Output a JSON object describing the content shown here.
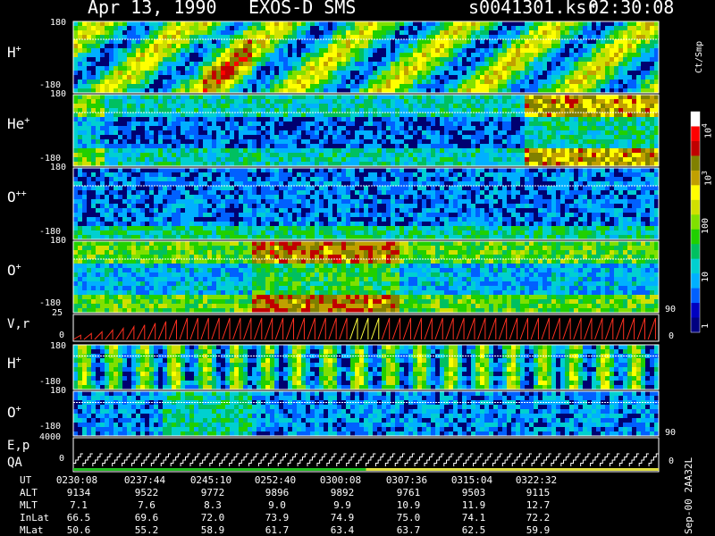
{
  "header": {
    "date": "Apr 13, 1990",
    "instrument": "EXOS-D SMS",
    "file": "s0041301.ksr",
    "time": "02:30:08"
  },
  "chart_data": {
    "type": "heatmap",
    "panels": [
      {
        "id": "h1",
        "label_main": "H",
        "label_sup": "+",
        "y_ticks": [
          "180",
          "-180"
        ],
        "right_ticks": []
      },
      {
        "id": "he",
        "label_main": "He",
        "label_sup": "+",
        "y_ticks": [
          "180",
          "-180"
        ],
        "right_ticks": []
      },
      {
        "id": "opp",
        "label_main": "O",
        "label_sup": "++",
        "y_ticks": [
          "180",
          "-180"
        ],
        "right_ticks": []
      },
      {
        "id": "o1",
        "label_main": "O",
        "label_sup": "+",
        "y_ticks": [
          "180",
          "-180"
        ],
        "right_ticks": [
          "90"
        ]
      },
      {
        "id": "vr",
        "label_main": "V,r",
        "label_sup": "",
        "y_ticks": [
          "25",
          "0"
        ],
        "right_ticks": [
          "0"
        ]
      },
      {
        "id": "h2",
        "label_main": "H",
        "label_sup": "+",
        "y_ticks": [
          "180",
          "-180"
        ],
        "right_ticks": []
      },
      {
        "id": "o2",
        "label_main": "O",
        "label_sup": "+",
        "y_ticks": [
          "180",
          "-180"
        ],
        "right_ticks": [
          "90"
        ]
      },
      {
        "id": "ep",
        "label_main": "E,p",
        "label_sup": "",
        "label2": "QA",
        "y_ticks": [
          "4000",
          "0"
        ],
        "right_ticks": [
          "0"
        ]
      }
    ],
    "colorbar": {
      "units": "Ct/Smp",
      "labels": [
        "10",
        "4",
        "10",
        "3",
        "100",
        "10",
        "1"
      ],
      "scale": "log",
      "range": [
        1,
        10000
      ],
      "colors": [
        "#000080",
        "#0000c0",
        "#0060ff",
        "#00b0ff",
        "#00d0d0",
        "#00c060",
        "#20d000",
        "#80e000",
        "#d0e000",
        "#ffff00",
        "#c0a000",
        "#808000",
        "#c00000",
        "#ff0000",
        "#ffffff"
      ]
    },
    "x_axis": {
      "ut": [
        "0230:08",
        "0237:44",
        "0245:10",
        "0252:40",
        "0300:08",
        "0307:36",
        "0315:04",
        "0322:32"
      ],
      "alt": [
        "9134",
        "9522",
        "9772",
        "9896",
        "9892",
        "9761",
        "9503",
        "9115"
      ],
      "mlt": [
        "7.1",
        "7.6",
        "8.3",
        "9.0",
        "9.9",
        "10.9",
        "11.9",
        "12.7"
      ],
      "inlat": [
        "66.5",
        "69.6",
        "72.0",
        "73.9",
        "74.9",
        "75.0",
        "74.1",
        "72.2"
      ],
      "mlat": [
        "50.6",
        "55.2",
        "58.9",
        "61.7",
        "63.4",
        "63.7",
        "62.5",
        "59.9"
      ]
    },
    "row_labels": {
      "ut": "UT",
      "alt": "ALT",
      "mlt": "MLT",
      "inlat": "InLat",
      "mlat": "MLat"
    },
    "footer": "Sep-00 2AA32L"
  }
}
